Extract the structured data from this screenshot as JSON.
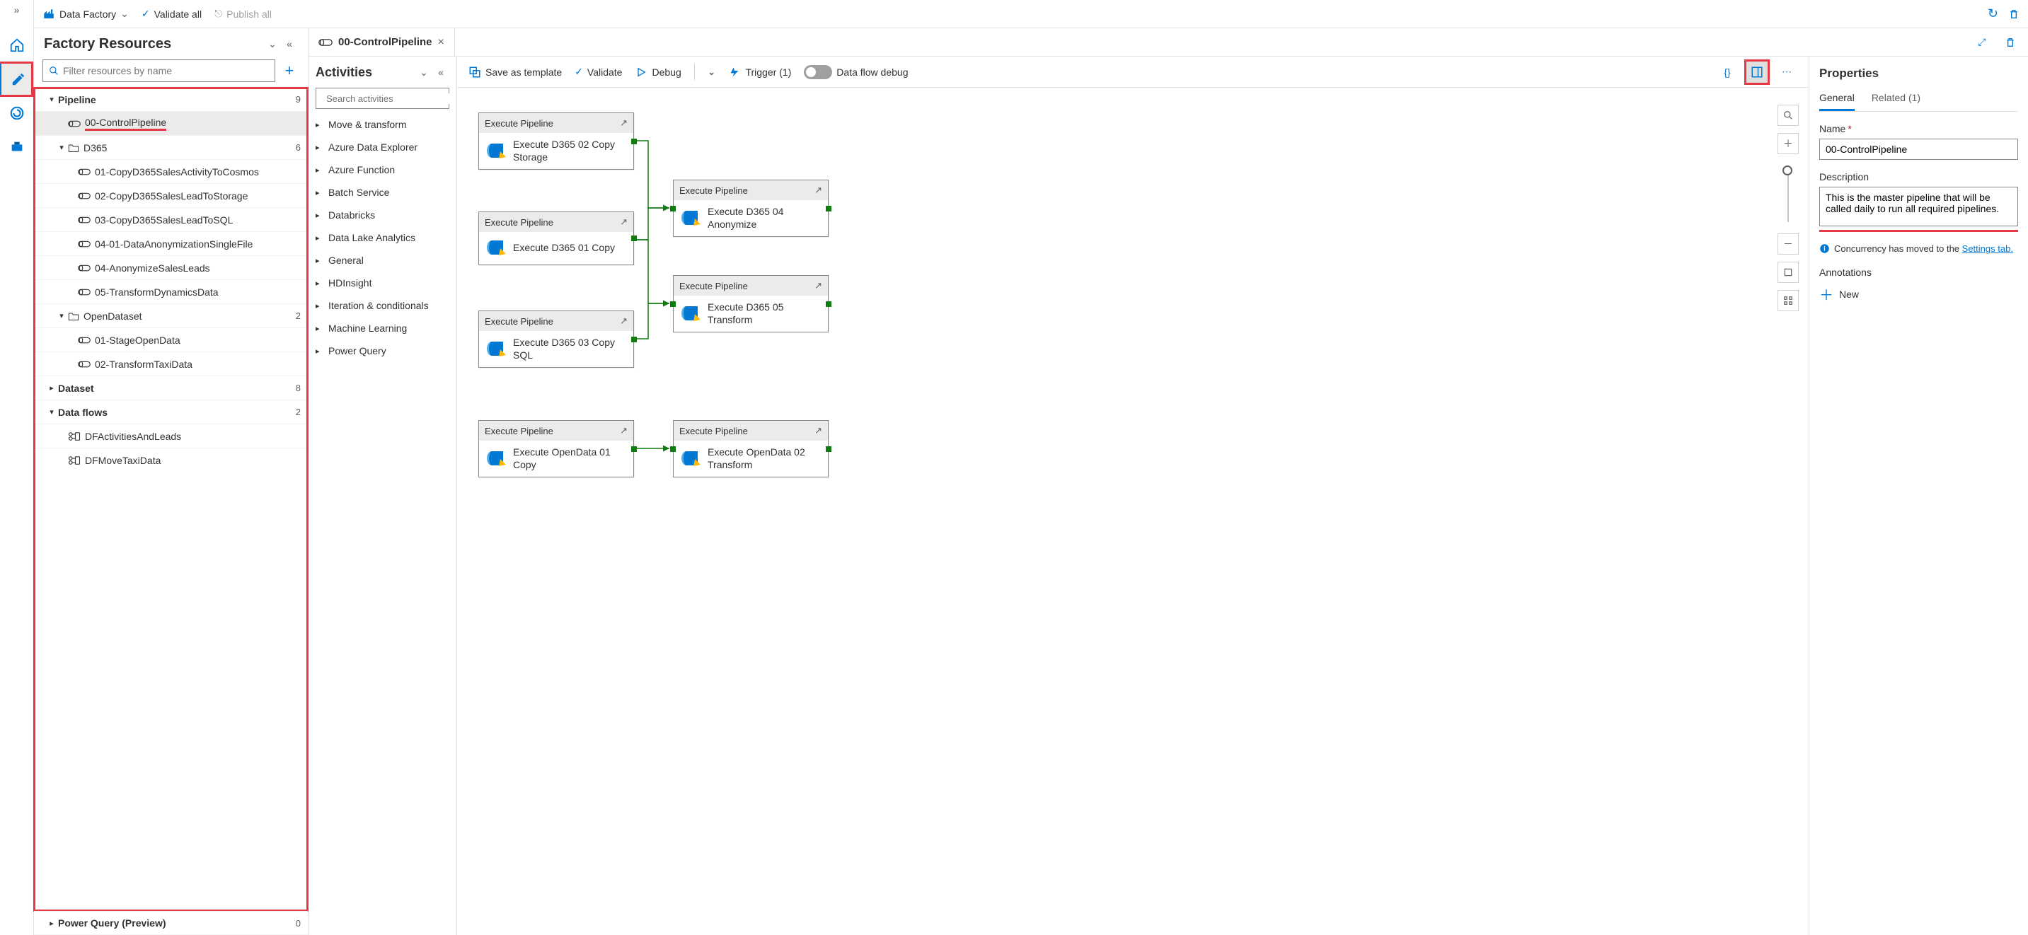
{
  "topbar": {
    "app_label": "Data Factory",
    "validate_all": "Validate all",
    "publish_all": "Publish all"
  },
  "resources": {
    "title": "Factory Resources",
    "filter_placeholder": "Filter resources by name",
    "pipeline": {
      "label": "Pipeline",
      "count": "9"
    },
    "control_pipeline": "00-ControlPipeline",
    "d365": {
      "label": "D365",
      "count": "6"
    },
    "d365_items": [
      "01-CopyD365SalesActivityToCosmos",
      "02-CopyD365SalesLeadToStorage",
      "03-CopyD365SalesLeadToSQL",
      "04-01-DataAnonymizationSingleFile",
      "04-AnonymizeSalesLeads",
      "05-TransformDynamicsData"
    ],
    "opendataset": {
      "label": "OpenDataset",
      "count": "2"
    },
    "opendataset_items": [
      "01-StageOpenData",
      "02-TransformTaxiData"
    ],
    "dataset": {
      "label": "Dataset",
      "count": "8"
    },
    "dataflows": {
      "label": "Data flows",
      "count": "2"
    },
    "dataflow_items": [
      "DFActivitiesAndLeads",
      "DFMoveTaxiData"
    ],
    "powerquery": {
      "label": "Power Query (Preview)",
      "count": "0"
    }
  },
  "tab": {
    "label": "00-ControlPipeline"
  },
  "activities": {
    "title": "Activities",
    "search_placeholder": "Search activities",
    "categories": [
      "Move & transform",
      "Azure Data Explorer",
      "Azure Function",
      "Batch Service",
      "Databricks",
      "Data Lake Analytics",
      "General",
      "HDInsight",
      "Iteration & conditionals",
      "Machine Learning",
      "Power Query"
    ]
  },
  "canvasbar": {
    "save_template": "Save as template",
    "validate": "Validate",
    "debug": "Debug",
    "trigger": "Trigger (1)",
    "dataflow_debug": "Data flow debug"
  },
  "nodes": {
    "header": "Execute Pipeline",
    "n1": "Execute D365 02 Copy Storage",
    "n2": "Execute D365 01 Copy",
    "n3": "Execute D365 03 Copy SQL",
    "n4": "Execute D365 04 Anonymize",
    "n5": "Execute D365 05 Transform",
    "n6": "Execute OpenData 01 Copy",
    "n7": "Execute OpenData 02 Transform"
  },
  "props": {
    "title": "Properties",
    "tab_general": "General",
    "tab_related": "Related (1)",
    "name_label": "Name",
    "name_value": "00-ControlPipeline",
    "desc_label": "Description",
    "desc_value": "This is the master pipeline that will be called daily to run all required pipelines.",
    "concurrency_text": "Concurrency has moved to the ",
    "concurrency_link": "Settings tab.",
    "annotations_label": "Annotations",
    "new_label": "New"
  }
}
